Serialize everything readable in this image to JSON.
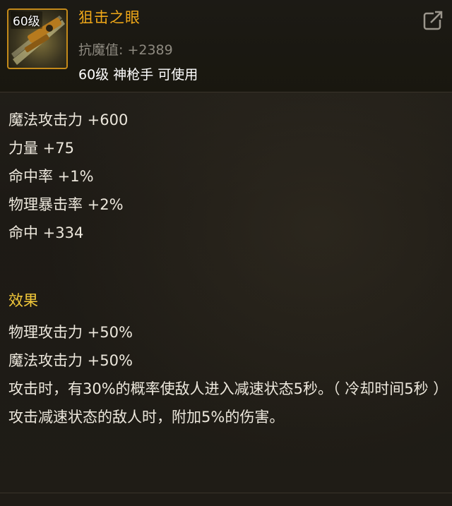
{
  "item": {
    "level_badge": "60级",
    "name": "狙击之眼",
    "resist_label": "抗魔值: +2389",
    "requirement": "60级 神枪手 可使用"
  },
  "stats": [
    "魔法攻击力 +600",
    "力量 +75",
    "命中率 +1%",
    "物理暴击率 +2%",
    "命中 +334"
  ],
  "effect": {
    "title": "效果",
    "lines": [
      "物理攻击力 +50%",
      "魔法攻击力 +50%",
      "攻击时，有30%的概率使敌人进入减速状态5秒。（ 冷却时间5秒 ）",
      "攻击减速状态的敌人时，附加5%的伤害。"
    ]
  },
  "icons": {
    "share": "share-icon",
    "item": "sniper-rifle-icon"
  },
  "colors": {
    "item_name": "#f0a818",
    "effect_title": "#f2c83a",
    "resist_text": "#8e8a80",
    "icon_border": "#c48a1a"
  }
}
